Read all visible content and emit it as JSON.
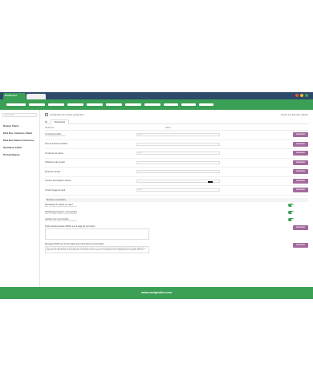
{
  "window": {
    "app_tab_label": "NextGestion",
    "dot_colors": [
      "#e8503a",
      "#f2b632",
      "#3c9f56"
    ]
  },
  "colors": {
    "brand_green": "#3c9f56",
    "topbar": "#2e4a6b",
    "button": "#a26a9c"
  },
  "sidebar": {
    "search_placeholder": "Rechercher",
    "items": [
      {
        "label": "Relevé Client"
      },
      {
        "label": "Etat Des créances Client"
      },
      {
        "label": "Etat Des Dettes Fournisse"
      },
      {
        "label": "Synthèse Client"
      },
      {
        "label": "Portail Relevé"
      }
    ]
  },
  "header": {
    "breadcrumb": "Configuration du module portail client",
    "back_link": "Retour à la liste des modules"
  },
  "tabs": [
    {
      "label": "Paramètres"
    }
  ],
  "params_header": {
    "col1": "Paramètre",
    "col2": "Valeur"
  },
  "params": [
    {
      "label": "Url d'accès public",
      "sublabel": "● Consulter le portail ouvert",
      "value": "http://",
      "button": "MODIFIER"
    },
    {
      "label": "Titre de l'accès extérieur",
      "sublabel": "",
      "value": "",
      "button": "MODIFIER"
    },
    {
      "label": "Url de lien de retour",
      "sublabel": "",
      "value": "http://",
      "button": "MODIFIER"
    },
    {
      "label": "Téléphone de contact",
      "sublabel": "",
      "value": "",
      "button": "MODIFIER"
    },
    {
      "label": "Email de contact",
      "sublabel": "",
      "value": "",
      "button": "MODIFIER"
    },
    {
      "label": "Couleur principale du thème",
      "sublabel": "",
      "value": "",
      "button": "MODIFIER"
    },
    {
      "label": "Url de l'image de fond",
      "sublabel": "",
      "value": "http://",
      "button": "MODIFIER"
    }
  ],
  "modules_section": {
    "title": "Modules accessibles"
  },
  "modules": [
    {
      "label": "Génération de relevé en client",
      "sublabel": "Non: Ces droits attachés sont à paramétrer",
      "enabled": true
    },
    {
      "label": "Télécharger factures, Commandes",
      "sublabel": "Non: Ces droits attachés sont à paramétrer",
      "enabled": true
    },
    {
      "label": "Création des commandes",
      "sublabel": "Non: Ces droits attachés sont à paramétrer",
      "enabled": true
    }
  ],
  "textarea_field": {
    "label": "Texte supplémentaire affiché sur la page de connexion",
    "button": "MODIFIER"
  },
  "message_field": {
    "label": "Message RGPD sur le formulaire des informations personnelles",
    "text": "Nous sommes demandeur et vérificateur des informations saisies sur ce formulaire pour la bonne gestion de votre compte client. Vous disposez d'un droit d'accès et de rectification aux données vous concernant, conformément à la réglementation en vigueur (RGPD).",
    "button": "MODIFIER"
  },
  "footer": {
    "text": "www.nextgestion.com"
  }
}
